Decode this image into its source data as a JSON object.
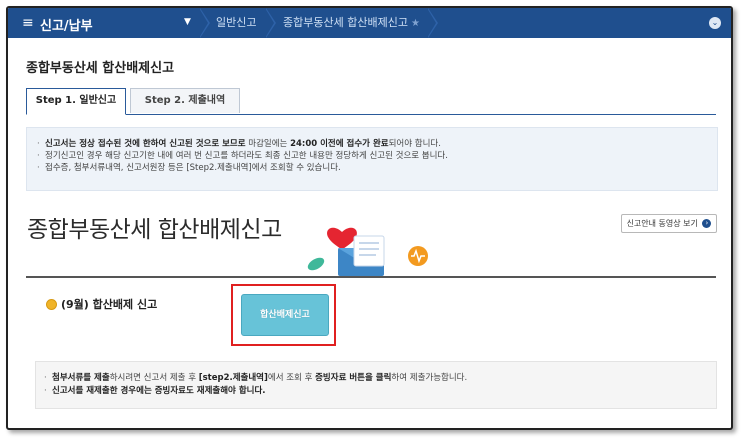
{
  "nav": {
    "menu_icon": "hamburger-icon",
    "title": "신고/납부",
    "dropdown_icon": "caret-down-icon",
    "breadcrumbs": [
      "일반신고",
      "종합부동산세 합산배제신고"
    ],
    "star_icon": "star-icon",
    "right_icon": "chevron-down-circle-icon",
    "right_glyph": "⌄",
    "bg_color": "#1f4f8e"
  },
  "page": {
    "title": "종합부동산세 합산배제신고"
  },
  "tabs": [
    {
      "label": "Step 1. 일반신고",
      "active": true
    },
    {
      "label": "Step 2. 제출내역",
      "active": false
    }
  ],
  "notice": {
    "line1_bold_a": "신고서는 정상 접수된 것에 한하여 신고된 것으로 보므로",
    "line1_mid": " 마감일에는 ",
    "line1_bold_b": "24:00 이전에 접수가 완료",
    "line1_end": "되어야 합니다.",
    "line2": "정기신고인 경우 해당 신고기한 내에 여러 번 신고를 하더라도 최종 신고한 내용만 정당하게 신고된 것으로 봅니다.",
    "line3": "접수증, 첨부서류내역, 신고서원장 등은 [Step2.제출내역]에서 조회할 수 있습니다."
  },
  "hero": {
    "title": "종합부동산세 합산배제신고",
    "video_link": "신고안내 동영상 보기",
    "video_link_icon": "arrow-circle-right-icon"
  },
  "section": {
    "label": "(9월) 합산배제 신고",
    "bullet_icon": "yellow-dot-icon",
    "button": "합산배제신고",
    "button_color": "#67c3d8",
    "highlight_color": "#e02020"
  },
  "footer": {
    "line1_bold_a": "첨부서류를 제출",
    "line1_mid_a": "하시려면 신고서 제출 후 ",
    "line1_bold_b": "[step2.제출내역]",
    "line1_mid_b": "에서 조회 후 ",
    "line1_bold_c": "증빙자료 버튼을 클릭",
    "line1_end": "하여 제출가능합니다.",
    "line2_bold": "신고서를 재제출한 경우에는 증빙자료도 재제출해야 합니다."
  }
}
